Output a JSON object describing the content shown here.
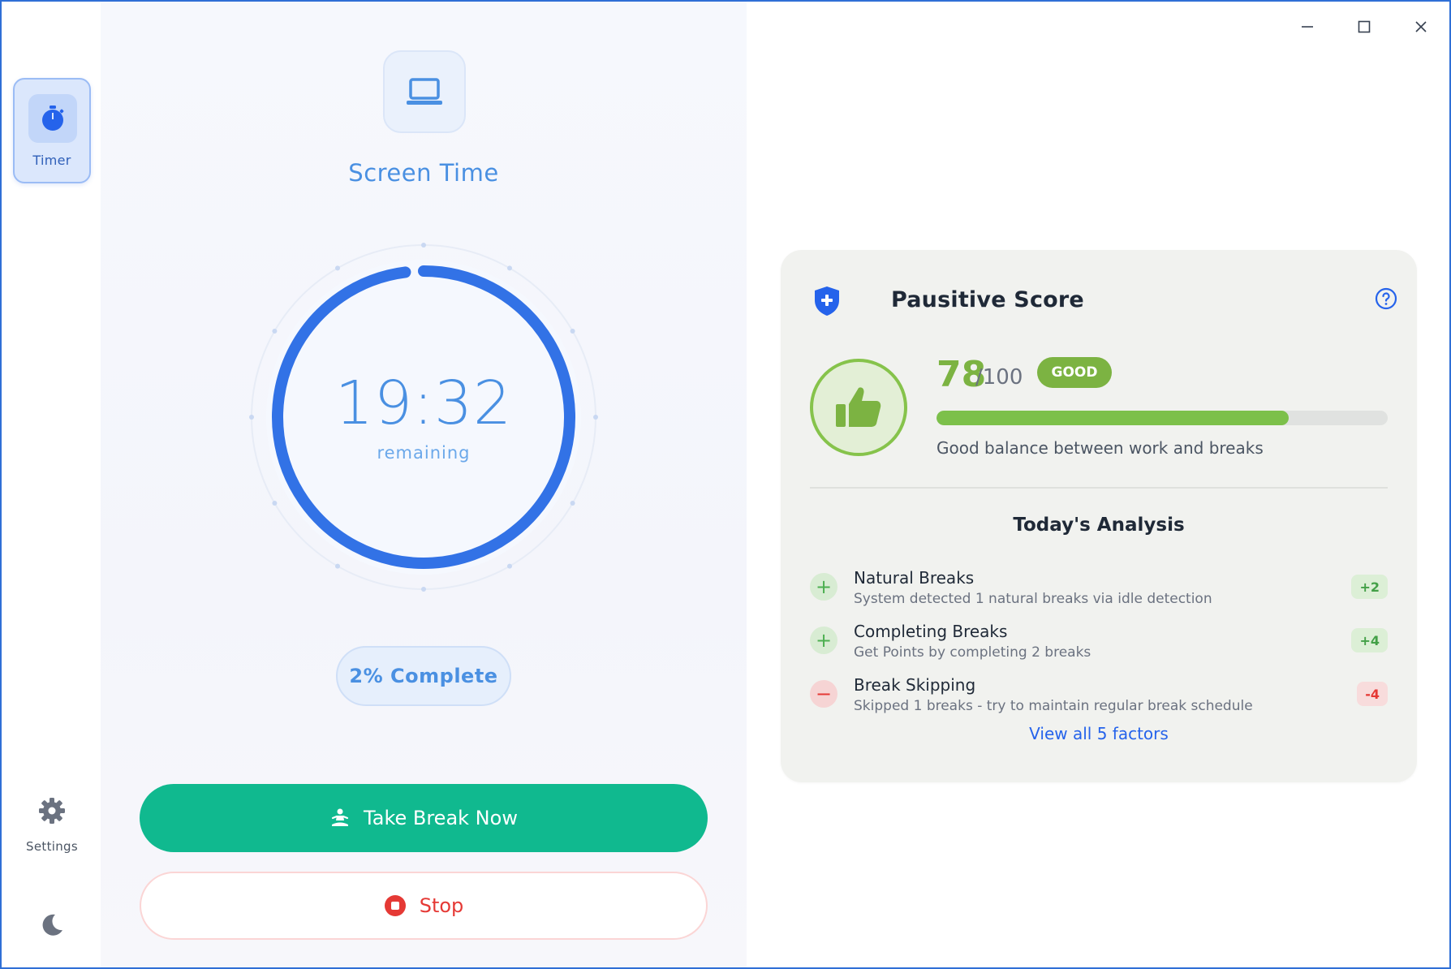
{
  "sidebar": {
    "timer_label": "Timer",
    "settings_label": "Settings"
  },
  "timer": {
    "title": "Screen Time",
    "time": "19:32",
    "remaining_label": "remaining",
    "progress_fraction": 0.02,
    "complete_label": "2% Complete",
    "take_break_label": "Take Break Now",
    "stop_label": "Stop"
  },
  "score": {
    "title": "Pausitive Score",
    "value": "78",
    "max": "/100",
    "fraction": 0.78,
    "badge": "GOOD",
    "description": "Good balance between work and breaks",
    "analysis_title": "Today's Analysis",
    "factors": [
      {
        "name": "Natural Breaks",
        "desc": "System detected 1 natural breaks via idle detection",
        "points": "+2",
        "sign": "+"
      },
      {
        "name": "Completing Breaks",
        "desc": "Get Points by completing 2 breaks",
        "points": "+4",
        "sign": "+"
      },
      {
        "name": "Break Skipping",
        "desc": "Skipped 1 breaks - try to maintain regular break schedule",
        "points": "-4",
        "sign": "−"
      }
    ],
    "view_all": "View all 5 factors"
  },
  "colors": {
    "accent": "#2f6fd6",
    "good": "#7cb342",
    "break_button": "#10b98f",
    "stop": "#e53935"
  },
  "icons": {
    "timer": "stopwatch-icon",
    "settings": "gear-icon",
    "theme": "moon-icon",
    "screen": "laptop-icon",
    "break": "meditation-icon",
    "stop": "stop-circle-icon",
    "score": "shield-icon",
    "help": "help-circle-icon",
    "rating": "thumbs-up-icon"
  }
}
